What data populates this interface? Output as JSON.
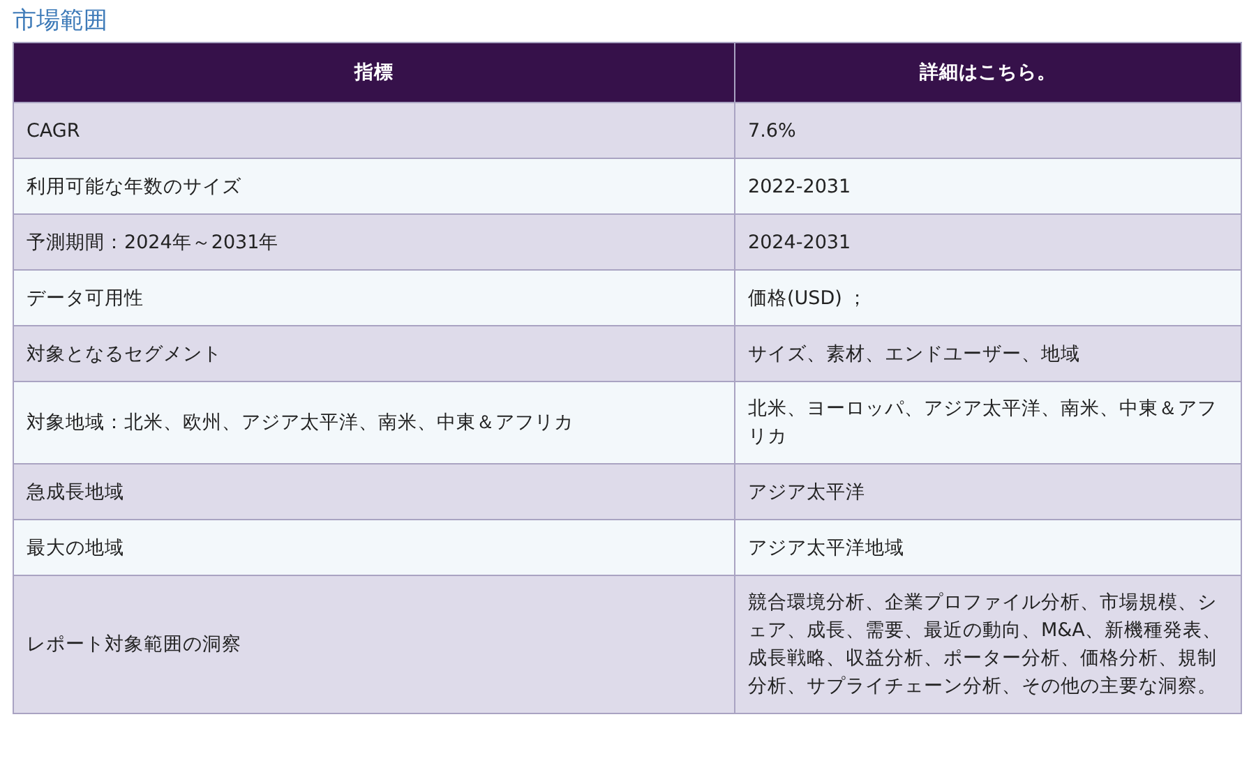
{
  "title": "市場範囲",
  "table": {
    "columns": [
      "指標",
      "詳細はこちら。"
    ],
    "rows": [
      [
        "CAGR",
        "7.6%"
      ],
      [
        "利用可能な年数のサイズ",
        "2022-2031"
      ],
      [
        "予測期間：2024年～2031年",
        "2024-2031"
      ],
      [
        "データ可用性",
        "価格(USD) ；"
      ],
      [
        "対象となるセグメント",
        "サイズ、素材、エンドユーザー、地域"
      ],
      [
        "対象地域：北米、欧州、アジア太平洋、南米、中東＆アフリカ",
        "北米、ヨーロッパ、アジア太平洋、南米、中東＆アフリカ"
      ],
      [
        "急成長地域",
        "アジア太平洋"
      ],
      [
        "最大の地域",
        "アジア太平洋地域"
      ],
      [
        "レポート対象範囲の洞察",
        "競合環境分析、企業プロファイル分析、市場規模、シェア、成長、需要、最近の動向、M&A、新機種発表、成長戦略、収益分析、ポーター分析、価格分析、規制分析、サプライチェーン分析、その他の主要な洞察。"
      ]
    ]
  }
}
